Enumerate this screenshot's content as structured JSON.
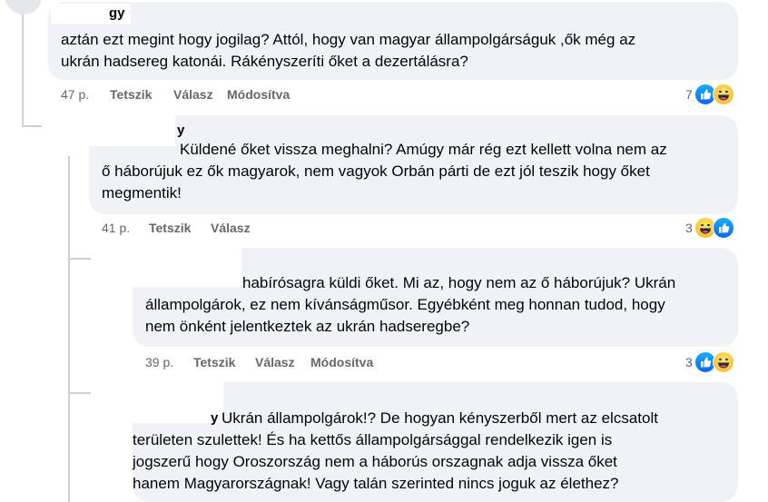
{
  "comments": [
    {
      "name_fragment": "gy",
      "lines": [
        "aztán ezt megint hogy jogilag? Attól, hogy van magyar állampolgárságuk ,ők még az",
        "ukrán hadsereg katonái. Rákényszeríti őket a dezertálásra?"
      ],
      "time": "47 p.",
      "like_label": "Tetszik",
      "reply_label": "Válasz",
      "edited_label": "Módosítva",
      "reaction_count": "7",
      "reactions": [
        "like-icon",
        "haha-icon"
      ]
    },
    {
      "name_fragment": "y",
      "lines": [
        "Küldené őket vissza meghalni? Amúgy már rég ezt kellett volna nem az",
        "ő háborújuk ez ők magyarok, nem vagyok Orbán párti de ezt jól teszik hogy őket",
        "megmentik!"
      ],
      "time": "41 p.",
      "like_label": "Tetszik",
      "reply_label": "Válasz",
      "reaction_count": "3",
      "reactions": [
        "haha-icon",
        "like-icon"
      ]
    },
    {
      "lines": [
        "habírósagra küldi őket. Mi az, hogy nem az ő háborújuk? Ukrán",
        "állampolgárok, ez nem kívánságműsor. Egyébként meg honnan tudod, hogy",
        "nem önként jelentkeztek az ukrán hadseregbe?"
      ],
      "time": "39 p.",
      "like_label": "Tetszik",
      "reply_label": "Válasz",
      "edited_label": "Módosítva",
      "reaction_count": "3",
      "reactions": [
        "like-icon",
        "haha-icon"
      ]
    },
    {
      "name_fragment": "y",
      "lines": [
        "Ukrán állampolgárok!? De hogyan kényszerből mert az elcsatolt",
        "területen szulettek! És ha kettős állampolgársággal rendelkezik igen is",
        "jogszerű hogy Oroszország nem a háborús orszagnak adja vissza őket",
        "hanem Magyarországnak! Vagy talán szerinted nincs joguk az élethez?"
      ]
    }
  ]
}
